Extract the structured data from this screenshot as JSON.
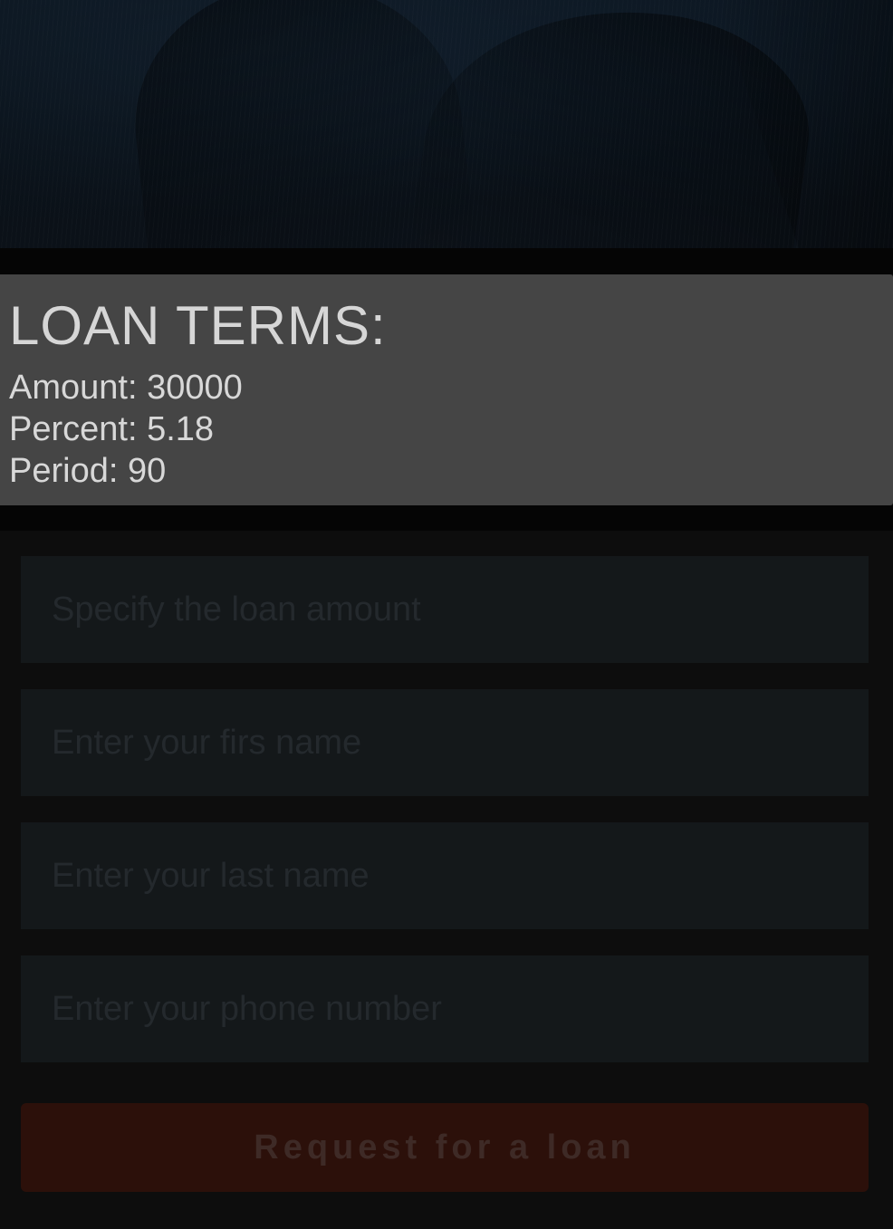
{
  "terms": {
    "title": "LOAN TERMS:",
    "amount": "Amount: 30000",
    "percent": "Percent: 5.18",
    "period": "Period: 90"
  },
  "form": {
    "amount_placeholder": "Specify the loan amount",
    "first_name_placeholder": "Enter your firs name",
    "last_name_placeholder": "Enter your last name",
    "phone_placeholder": "Enter your phone number",
    "submit_label": "Request for a loan"
  },
  "colors": {
    "terms_background": "#454545",
    "field_background": "#14181a",
    "button_background": "#2c100a"
  }
}
